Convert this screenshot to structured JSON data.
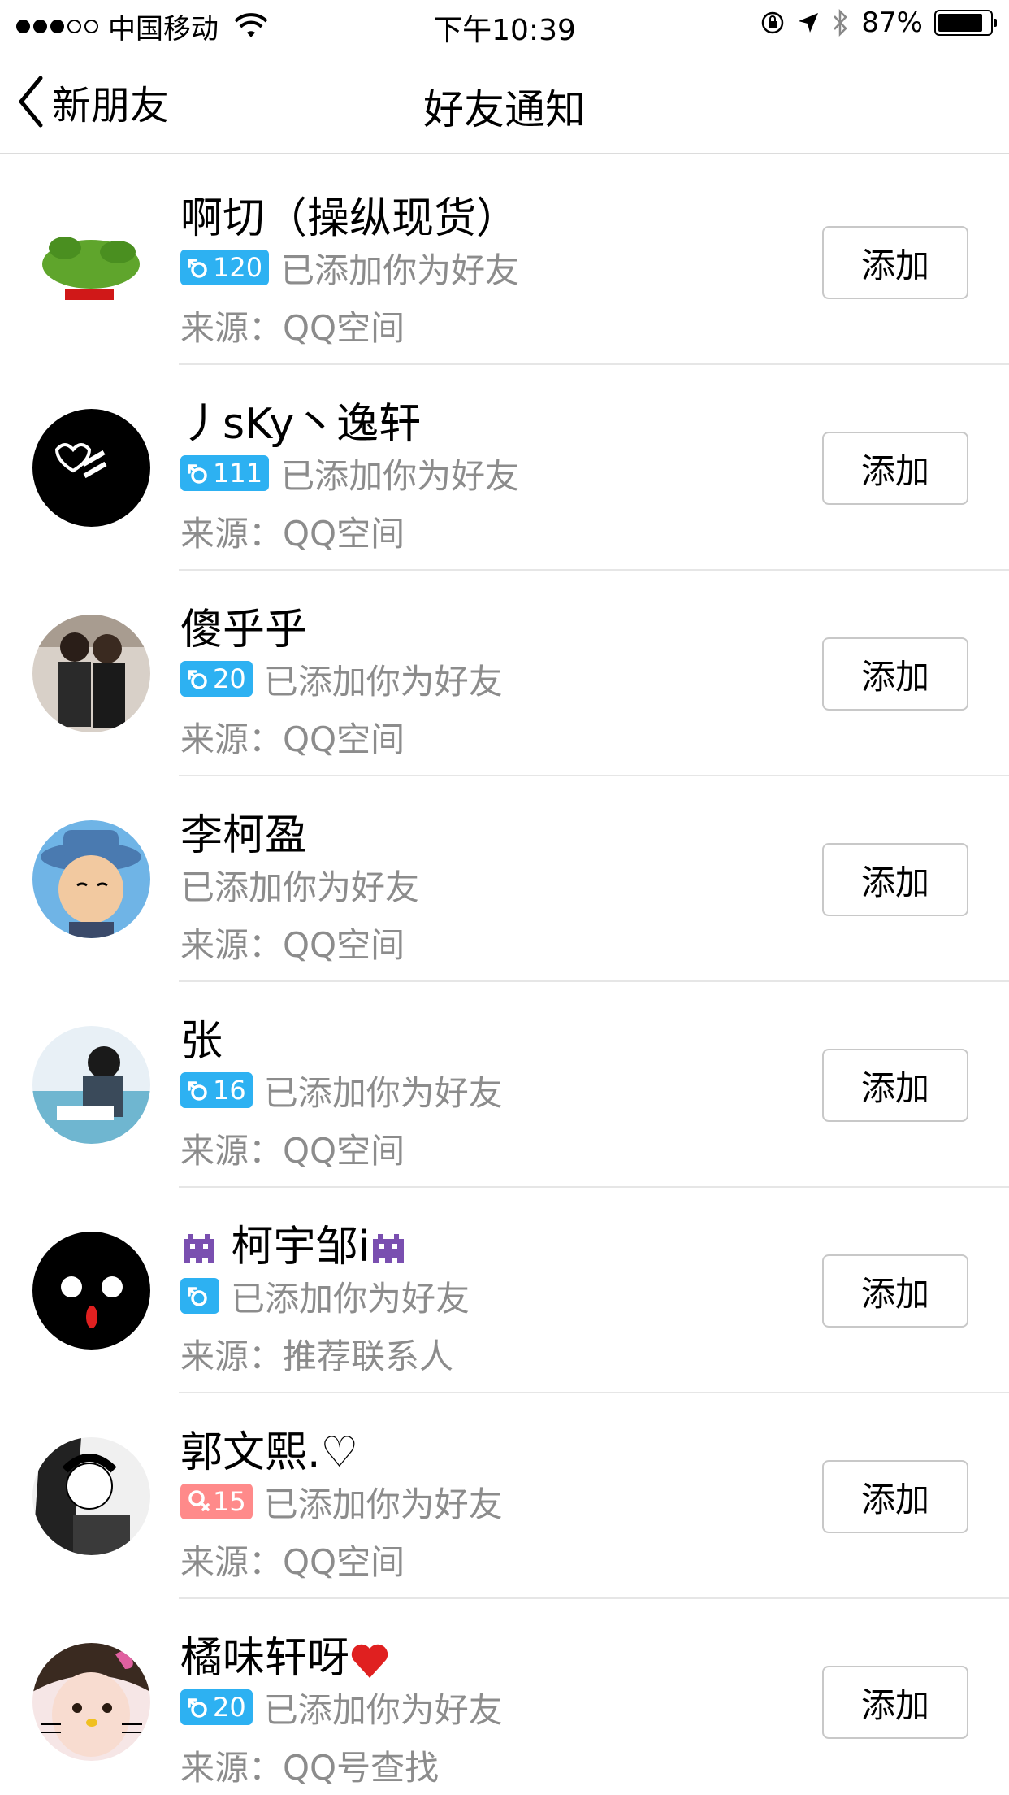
{
  "status_bar": {
    "carrier": "中国移动",
    "time": "下午10:39",
    "battery_percent": "87%",
    "battery_level": 0.87,
    "signal_bars_filled": 3,
    "signal_bars_total": 5
  },
  "nav": {
    "back_label": "新朋友",
    "title": "好友通知"
  },
  "friend_requests": [
    {
      "name": "啊切（操纵现货）",
      "badge": "120",
      "gender": "male",
      "status": "已添加你为好友",
      "source": "来源：QQ空间",
      "action": "添加",
      "avatar_colors": [
        "#ffffff",
        "#5fa52c"
      ]
    },
    {
      "name": "丿sKy丶逸轩",
      "badge": "111",
      "gender": "male",
      "status": "已添加你为好友",
      "source": "来源：QQ空间",
      "action": "添加",
      "avatar_colors": [
        "#000000",
        "#ffffff"
      ]
    },
    {
      "name": "傻乎乎",
      "badge": "20",
      "gender": "male",
      "status": "已添加你为好友",
      "source": "来源：QQ空间",
      "action": "添加",
      "avatar_colors": [
        "#d8d0c8",
        "#2a2a2a"
      ]
    },
    {
      "name": "李柯盈",
      "badge": "",
      "gender": "none",
      "status": "已添加你为好友",
      "source": "来源：QQ空间",
      "action": "添加",
      "avatar_colors": [
        "#6fb4e6",
        "#f2c9a0"
      ]
    },
    {
      "name": "张",
      "badge": "16",
      "gender": "male",
      "status": "已添加你为好友",
      "source": "来源：QQ空间",
      "action": "添加",
      "avatar_colors": [
        "#e8f0f6",
        "#3a4a5a"
      ]
    },
    {
      "name": "柯宇邹i",
      "badge": "",
      "gender": "male",
      "status": "已添加你为好友",
      "source": "来源：推荐联系人",
      "action": "添加",
      "avatar_colors": [
        "#000000",
        "#ffffff"
      ]
    },
    {
      "name": "郭文熙.♡",
      "badge": "15",
      "gender": "female",
      "status": "已添加你为好友",
      "source": "来源：QQ空间",
      "action": "添加",
      "avatar_colors": [
        "#f0f0f0",
        "#3a3a3a"
      ]
    },
    {
      "name": "橘味轩呀",
      "badge": "20",
      "gender": "male",
      "status": "已添加你为好友",
      "source": "来源：QQ号查找",
      "action": "添加",
      "avatar_colors": [
        "#f6e6e6",
        "#e060a0"
      ]
    }
  ],
  "colors": {
    "male_badge": "#2db1f2",
    "female_badge": "#ff8a8a",
    "secondary_text": "#8c8c8c",
    "divider": "#e6e6e6"
  }
}
